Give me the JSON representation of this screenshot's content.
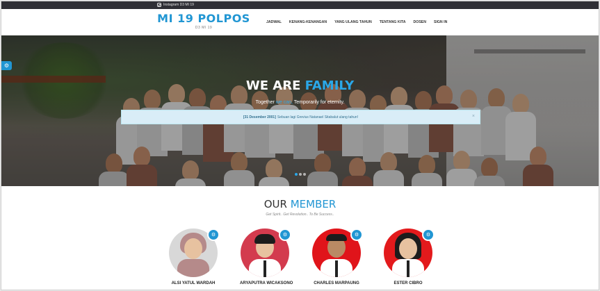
{
  "topbar": {
    "instagram_label": "Instagram D3 MI 19",
    "instagram_icon": "instagram-icon"
  },
  "brand": {
    "title": "MI 19 POLPOS",
    "subtitle": "D3 MI 19"
  },
  "nav": [
    {
      "label": "JADWAL"
    },
    {
      "label": "KENANG-KENANGAN"
    },
    {
      "label": "YANG ULANG TAHUN"
    },
    {
      "label": "TENTANG KITA"
    },
    {
      "label": "DOSEN"
    },
    {
      "label": "SIGN IN"
    }
  ],
  "hero": {
    "title_part1": "WE ARE ",
    "title_part2": "FAMILY",
    "subtitle_part1": "Together ",
    "subtitle_part2": "we can,",
    "subtitle_part3": " Temporarily for eternity.",
    "alert_date": "[31 Desember 2001]",
    "alert_text": "Sebuan lagi Grevius Natanael Sitabalut ulang tahun!",
    "alert_close": "×",
    "slide_count": 3,
    "active_slide": 1
  },
  "members_section": {
    "title_part1": "OUR ",
    "title_part2": "MEMBER",
    "tagline": "Get Spirit.. Get Revolution.. To Be Success.."
  },
  "members": [
    {
      "name": "ALSI YATUL WARDAH",
      "background": "#d8d8d8"
    },
    {
      "name": "ARYAPUTRA WICAKSONO",
      "background": "#d33b4e"
    },
    {
      "name": "CHARLES MARPAUNG",
      "background": "#e0141a"
    },
    {
      "name": "ESTER CIBRO",
      "background": "#e31a1c"
    }
  ],
  "colors": {
    "accent": "#2196d3",
    "topbar": "#2f2f35",
    "alert_bg": "#d9edf7"
  }
}
